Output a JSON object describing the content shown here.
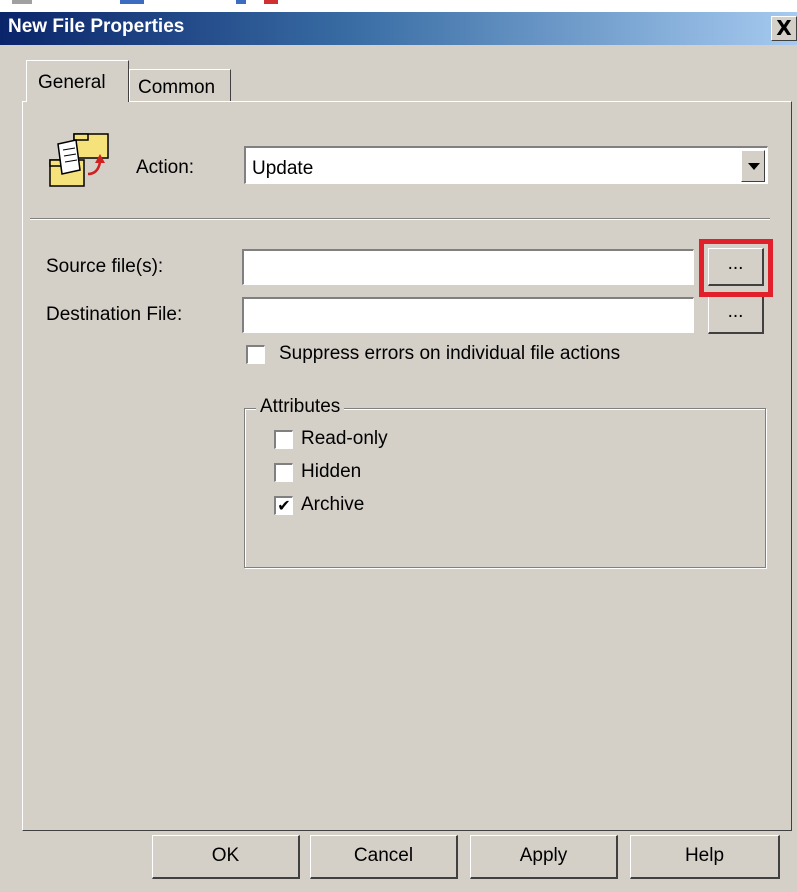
{
  "window": {
    "title": "New File Properties",
    "close_glyph": "X"
  },
  "tabs": [
    {
      "label": "General",
      "active": true
    },
    {
      "label": "Common",
      "active": false
    }
  ],
  "action": {
    "label": "Action:",
    "value": "Update",
    "icon": "file-copy-icon"
  },
  "source": {
    "label": "Source file(s):",
    "value": "",
    "browse_label": "..."
  },
  "destination": {
    "label": "Destination File:",
    "value": "",
    "browse_label": "..."
  },
  "suppress_errors": {
    "label": "Suppress errors on individual file actions",
    "checked": false
  },
  "attributes": {
    "title": "Attributes",
    "items": [
      {
        "label": "Read-only",
        "checked": false
      },
      {
        "label": "Hidden",
        "checked": false
      },
      {
        "label": "Archive",
        "checked": true
      }
    ]
  },
  "buttons": {
    "ok": "OK",
    "cancel": "Cancel",
    "apply": "Apply",
    "help": "Help"
  },
  "colors": {
    "highlight": "#e0202a",
    "titlebar_start": "#0a246a",
    "titlebar_end": "#a6caf0",
    "dialog_face": "#d4d0c8"
  }
}
